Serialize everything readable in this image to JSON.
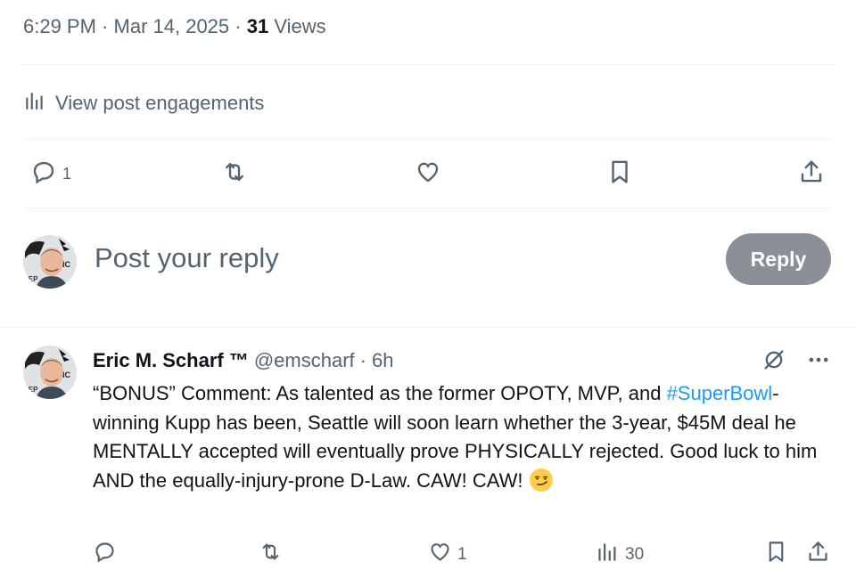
{
  "meta": {
    "time": "6:29 PM",
    "sep1": "·",
    "date": "Mar 14, 2025",
    "sep2": "·",
    "views_count": "31",
    "views_label": "Views"
  },
  "engagements": {
    "label": "View post engagements",
    "icon": "analytics-icon"
  },
  "actions": {
    "reply_count": "1",
    "icons": [
      "reply-icon",
      "repost-icon",
      "like-icon",
      "bookmark-icon",
      "share-icon"
    ]
  },
  "reply_box": {
    "placeholder": "Post your reply",
    "button_label": "Reply",
    "button_color": "#8b9096"
  },
  "tweet": {
    "author_name": "Eric M. Scharf ™",
    "handle": "@emscharf",
    "sep": "·",
    "time": "6h",
    "text_before_tag": "“BONUS” Comment: As talented as the former OPOTY, MVP, and ",
    "hashtag": "#SuperBowl",
    "text_after_tag": "-winning Kupp has been, Seattle will soon learn whether the 3-year, $45M deal he MENTALLY accepted will eventually prove PHYSICALLY rejected. Good luck to him AND the equally-injury-prone D-Law. CAW! CAW! ",
    "emoji": "smirking-face-emoji",
    "like_count": "1",
    "views_count": "30"
  },
  "colors": {
    "text": "#0f1419",
    "secondary": "#536471",
    "link": "#1d9bf0",
    "divider": "#eff3f4"
  }
}
